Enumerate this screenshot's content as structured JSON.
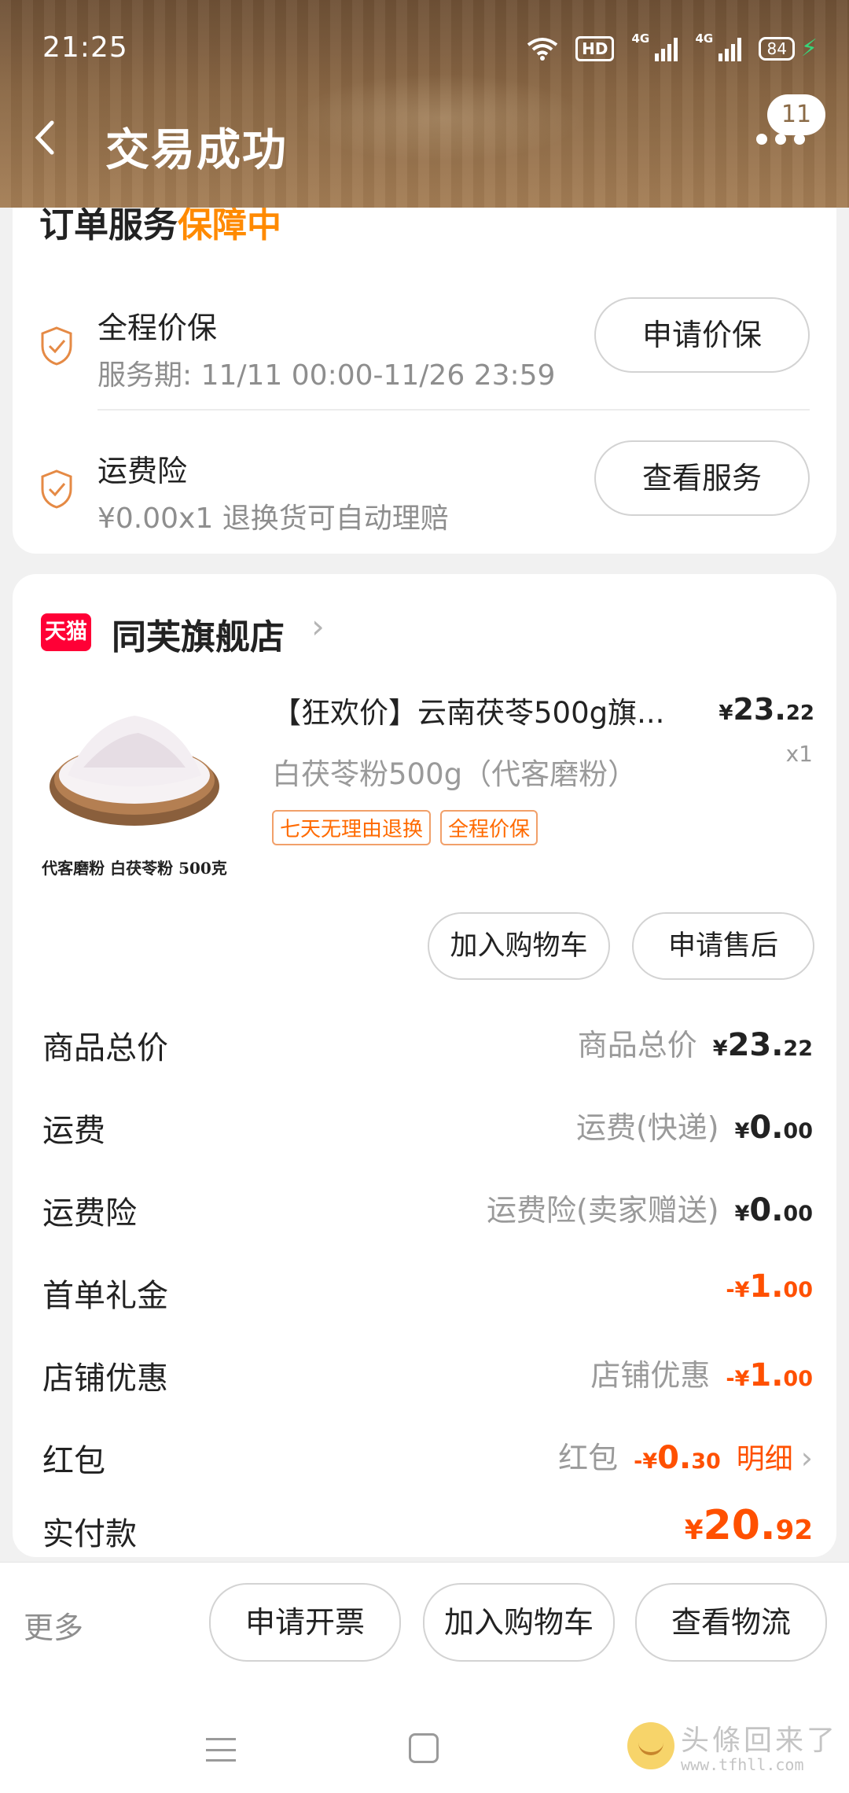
{
  "status_bar": {
    "time": "21:25",
    "hd": "HD",
    "signal1": "4G",
    "signal2": "4G",
    "battery": "84"
  },
  "header": {
    "title": "交易成功",
    "badge_count": "11"
  },
  "service": {
    "heading_prefix": "订单服务",
    "heading_highlight": "保障中",
    "items": [
      {
        "title": "全程价保",
        "subtitle": "服务期: 11/11 00:00-11/26 23:59",
        "button": "申请价保",
        "icon": "shield-check-icon"
      },
      {
        "title": "运费险",
        "subtitle": "¥0.00x1  退换货可自动理赔",
        "button": "查看服务",
        "icon": "shield-check-icon"
      }
    ]
  },
  "shop": {
    "logo_text": "天猫",
    "name": "同芙旗舰店"
  },
  "product": {
    "title": "【狂欢价】云南茯苓500g旗...",
    "sku": "白茯苓粉500g（代客磨粉）",
    "image_caption": "代客磨粉  白茯苓粉 500克",
    "price_currency": "¥",
    "price_int": "23.",
    "price_dec": "22",
    "qty": "x1",
    "tags": [
      "七天无理由退换",
      "全程价保"
    ],
    "buttons": {
      "add_cart": "加入购物车",
      "after_sale": "申请售后"
    }
  },
  "fees": [
    {
      "label": "商品总价",
      "desc": "商品总价",
      "sign": "",
      "yen": "¥",
      "int": "23.",
      "dec": "22",
      "negative": false
    },
    {
      "label": "运费",
      "desc": "运费(快递)",
      "sign": "",
      "yen": "¥",
      "int": "0.",
      "dec": "00",
      "negative": false
    },
    {
      "label": "运费险",
      "desc": "运费险(卖家赠送)",
      "sign": "",
      "yen": "¥",
      "int": "0.",
      "dec": "00",
      "negative": false
    },
    {
      "label": "首单礼金",
      "desc": "",
      "sign": "-",
      "yen": "¥",
      "int": "1.",
      "dec": "00",
      "negative": true
    },
    {
      "label": "店铺优惠",
      "desc": "店铺优惠",
      "sign": "-",
      "yen": "¥",
      "int": "1.",
      "dec": "00",
      "negative": true
    },
    {
      "label": "红包",
      "desc": "红包",
      "sign": "-",
      "yen": "¥",
      "int": "0.",
      "dec": "30",
      "negative": true,
      "link": "明细"
    }
  ],
  "total": {
    "label": "实付款",
    "yen": "¥",
    "int": "20.",
    "dec": "92"
  },
  "bottom_bar": {
    "more": "更多",
    "invoice": "申请开票",
    "add_cart": "加入购物车",
    "logistics": "查看物流"
  },
  "watermark": {
    "title": "头條回来了",
    "url": "www.tfhll.com"
  },
  "colors": {
    "accent": "#ff5000",
    "tag_border": "#f1a06a",
    "header": "#8b6845",
    "tmall": "#ff0036"
  }
}
